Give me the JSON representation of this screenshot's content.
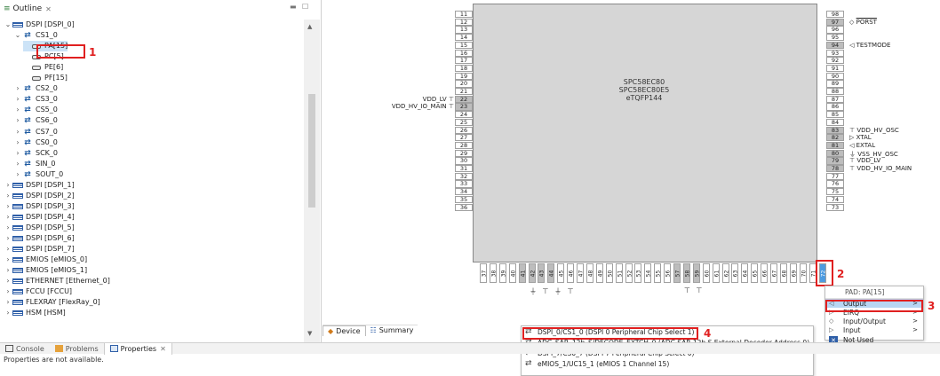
{
  "outline": {
    "title": "Outline",
    "tree": [
      {
        "label": "DSPI [DSPI_0]",
        "level": 0,
        "icon": "module-icon",
        "twisty": "v"
      },
      {
        "label": "CS1_0",
        "level": 1,
        "icon": "arrows-icon",
        "twisty": "v"
      },
      {
        "label": "PA[15]",
        "level": 2,
        "icon": "pad-icon",
        "twisty": "",
        "selected": true
      },
      {
        "label": "PC[5]",
        "level": 2,
        "icon": "pad-icon",
        "twisty": ""
      },
      {
        "label": "PE[6]",
        "level": 2,
        "icon": "pad-icon",
        "twisty": ""
      },
      {
        "label": "PF[15]",
        "level": 2,
        "icon": "pad-icon",
        "twisty": ""
      },
      {
        "label": "CS2_0",
        "level": 1,
        "icon": "arrows-icon",
        "twisty": ">"
      },
      {
        "label": "CS3_0",
        "level": 1,
        "icon": "arrows-icon",
        "twisty": ">"
      },
      {
        "label": "CS5_0",
        "level": 1,
        "icon": "arrows-icon",
        "twisty": ">"
      },
      {
        "label": "CS6_0",
        "level": 1,
        "icon": "arrows-icon",
        "twisty": ">"
      },
      {
        "label": "CS7_0",
        "level": 1,
        "icon": "arrows-icon",
        "twisty": ">"
      },
      {
        "label": "CS0_0",
        "level": 1,
        "icon": "arrows-icon",
        "twisty": ">"
      },
      {
        "label": "SCK_0",
        "level": 1,
        "icon": "arrows-icon",
        "twisty": ">"
      },
      {
        "label": "SIN_0",
        "level": 1,
        "icon": "arrows-icon",
        "twisty": ">"
      },
      {
        "label": "SOUT_0",
        "level": 1,
        "icon": "arrows-icon",
        "twisty": ">"
      },
      {
        "label": "DSPI [DSPI_1]",
        "level": 0,
        "icon": "module-icon",
        "twisty": ">"
      },
      {
        "label": "DSPI [DSPI_2]",
        "level": 0,
        "icon": "module-icon",
        "twisty": ">"
      },
      {
        "label": "DSPI [DSPI_3]",
        "level": 0,
        "icon": "module-icon",
        "twisty": ">"
      },
      {
        "label": "DSPI [DSPI_4]",
        "level": 0,
        "icon": "module-icon",
        "twisty": ">"
      },
      {
        "label": "DSPI [DSPI_5]",
        "level": 0,
        "icon": "module-icon",
        "twisty": ">"
      },
      {
        "label": "DSPI [DSPI_6]",
        "level": 0,
        "icon": "module-icon",
        "twisty": ">"
      },
      {
        "label": "DSPI [DSPI_7]",
        "level": 0,
        "icon": "module-icon",
        "twisty": ">"
      },
      {
        "label": "EMIOS [eMIOS_0]",
        "level": 0,
        "icon": "module-icon",
        "twisty": ">"
      },
      {
        "label": "EMIOS [eMIOS_1]",
        "level": 0,
        "icon": "module-icon",
        "twisty": ">"
      },
      {
        "label": "ETHERNET [Ethernet_0]",
        "level": 0,
        "icon": "module-icon",
        "twisty": ">"
      },
      {
        "label": "FCCU [FCCU]",
        "level": 0,
        "icon": "module-icon",
        "twisty": ">"
      },
      {
        "label": "FLEXRAY [FlexRay_0]",
        "level": 0,
        "icon": "module-icon",
        "twisty": ">"
      },
      {
        "label": "HSM [HSM]",
        "level": 0,
        "icon": "module-icon",
        "twisty": ">"
      }
    ]
  },
  "annotations": [
    "1",
    "2",
    "3",
    "4"
  ],
  "bottom_tabs": [
    {
      "label": "Console",
      "icon": "console-icon"
    },
    {
      "label": "Problems",
      "icon": "problems-icon"
    },
    {
      "label": "Properties",
      "icon": "properties-icon",
      "active": true
    }
  ],
  "status_text": "Properties are not available.",
  "device_tabs": [
    {
      "label": "Device",
      "icon": "device-icon",
      "active": true
    },
    {
      "label": "Summary",
      "icon": "summary-icon"
    }
  ],
  "chip": {
    "name_lines": [
      "SPC58EC80",
      "SPC58EC80E5",
      "eTQFP144"
    ],
    "left_pins": [
      "11",
      "12",
      "13",
      "14",
      "15",
      "16",
      "17",
      "18",
      "19",
      "20",
      "21",
      "22",
      "23",
      "24",
      "25",
      "26",
      "27",
      "28",
      "29",
      "30",
      "31",
      "32",
      "33",
      "34",
      "35",
      "36"
    ],
    "right_pins": [
      "98",
      "97",
      "96",
      "95",
      "94",
      "93",
      "92",
      "91",
      "90",
      "89",
      "88",
      "87",
      "86",
      "85",
      "84",
      "83",
      "82",
      "81",
      "80",
      "79",
      "78",
      "77",
      "76",
      "75",
      "74",
      "73"
    ],
    "bottom_pins": [
      "37",
      "38",
      "39",
      "40",
      "41",
      "42",
      "43",
      "44",
      "45",
      "46",
      "47",
      "48",
      "49",
      "50",
      "51",
      "52",
      "53",
      "54",
      "55",
      "56",
      "57",
      "58",
      "59",
      "60",
      "61",
      "62",
      "63",
      "64",
      "65",
      "66",
      "67",
      "68",
      "69",
      "70",
      "71",
      "72"
    ],
    "left_labels": [
      {
        "pin": "22",
        "text": "VDD_LV"
      },
      {
        "pin": "23",
        "text": "VDD_HV_IO_MAIN"
      }
    ],
    "right_labels": [
      {
        "pin": "97",
        "text": "PORST"
      },
      {
        "pin": "94",
        "text": "TESTMODE"
      },
      {
        "pin": "83",
        "text": "VDD_HV_OSC"
      },
      {
        "pin": "82",
        "text": "XTAL"
      },
      {
        "pin": "81",
        "text": "EXTAL"
      },
      {
        "pin": "80",
        "text": "VSS_HV_OSC"
      },
      {
        "pin": "79",
        "text": "VDD_LV"
      },
      {
        "pin": "78",
        "text": "VDD_HV_IO_MAIN"
      }
    ]
  },
  "pin_menu": {
    "items": [
      "DSPI_0/CS1_0 (DSPI 0 Peripheral Chip Select 1)",
      "ADC_SAR_12b_S/DECODE_EXTCH_0 (ADC SAR 12b S External Decoder Address 0)",
      "DSPI_7/CS0_7 (DSPI 7 Peripheral Chip Select 0)",
      "eMIOS_1/UC15_1 (eMIOS 1 Channel 15)"
    ]
  },
  "pad_menu": {
    "header": "PAD: PA[15]",
    "items": [
      {
        "label": "Output",
        "submenu": true,
        "highlighted": true
      },
      {
        "label": "EIRQ",
        "submenu": true
      },
      {
        "label": "Input/Output",
        "submenu": true
      },
      {
        "label": "Input",
        "submenu": true
      },
      {
        "label": "Not Used",
        "submenu": false
      }
    ]
  }
}
